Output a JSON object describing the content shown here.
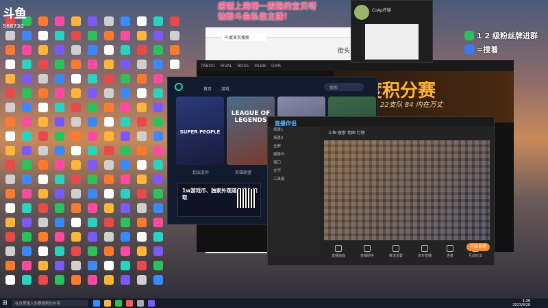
{
  "overlay": {
    "logo_text": "斗鱼",
    "room_number": "568730",
    "banner_line1": "感谢上周榜一拔稳的宝贝呀",
    "banner_line2": "钻粉斗鱼私信主播！",
    "fans_line1": "1 2 级粉丝牌进群",
    "fans_line2": "=搜着"
  },
  "wechat": {
    "name": "CoAp传输"
  },
  "browser": {
    "tab_label": "千度首页搜索",
    "page_text": "街头"
  },
  "douyu": {
    "tabs": [
      "TABOO",
      "RIVAL",
      "BOSS",
      "MLBB",
      "GMR"
    ],
    "poster_title": "度积分赛",
    "poster_sub": "22支队 84 内在万丈"
  },
  "launcher": {
    "nav": [
      "首页",
      "游戏"
    ],
    "search_placeholder": "搜索",
    "cards": [
      {
        "title": "SUPER PEOPLE",
        "label": "超出变异"
      },
      {
        "title": "LEAGUE OF LEGENDS",
        "label": "英雄联盟"
      }
    ],
    "promo_text": "1w游戏币、独家外观道具待你领取"
  },
  "stream": {
    "app_title": "直播伴侣",
    "address": "斗鱼·搜索 地图 打榜",
    "sidebar": [
      "场景1",
      "场景2",
      "全屏",
      "摄像头",
      "窗口",
      "文字",
      "工具箱"
    ],
    "tools": [
      "直播画面",
      "直播助手",
      "推流设置",
      "多开直播",
      "连麦",
      "互动玩法",
      "直播间"
    ],
    "go_live": "开始直播"
  },
  "taskbar": {
    "search_placeholder": "在这里输入你要搜索的内容",
    "time": "1:36",
    "date": "2023/8/28"
  }
}
